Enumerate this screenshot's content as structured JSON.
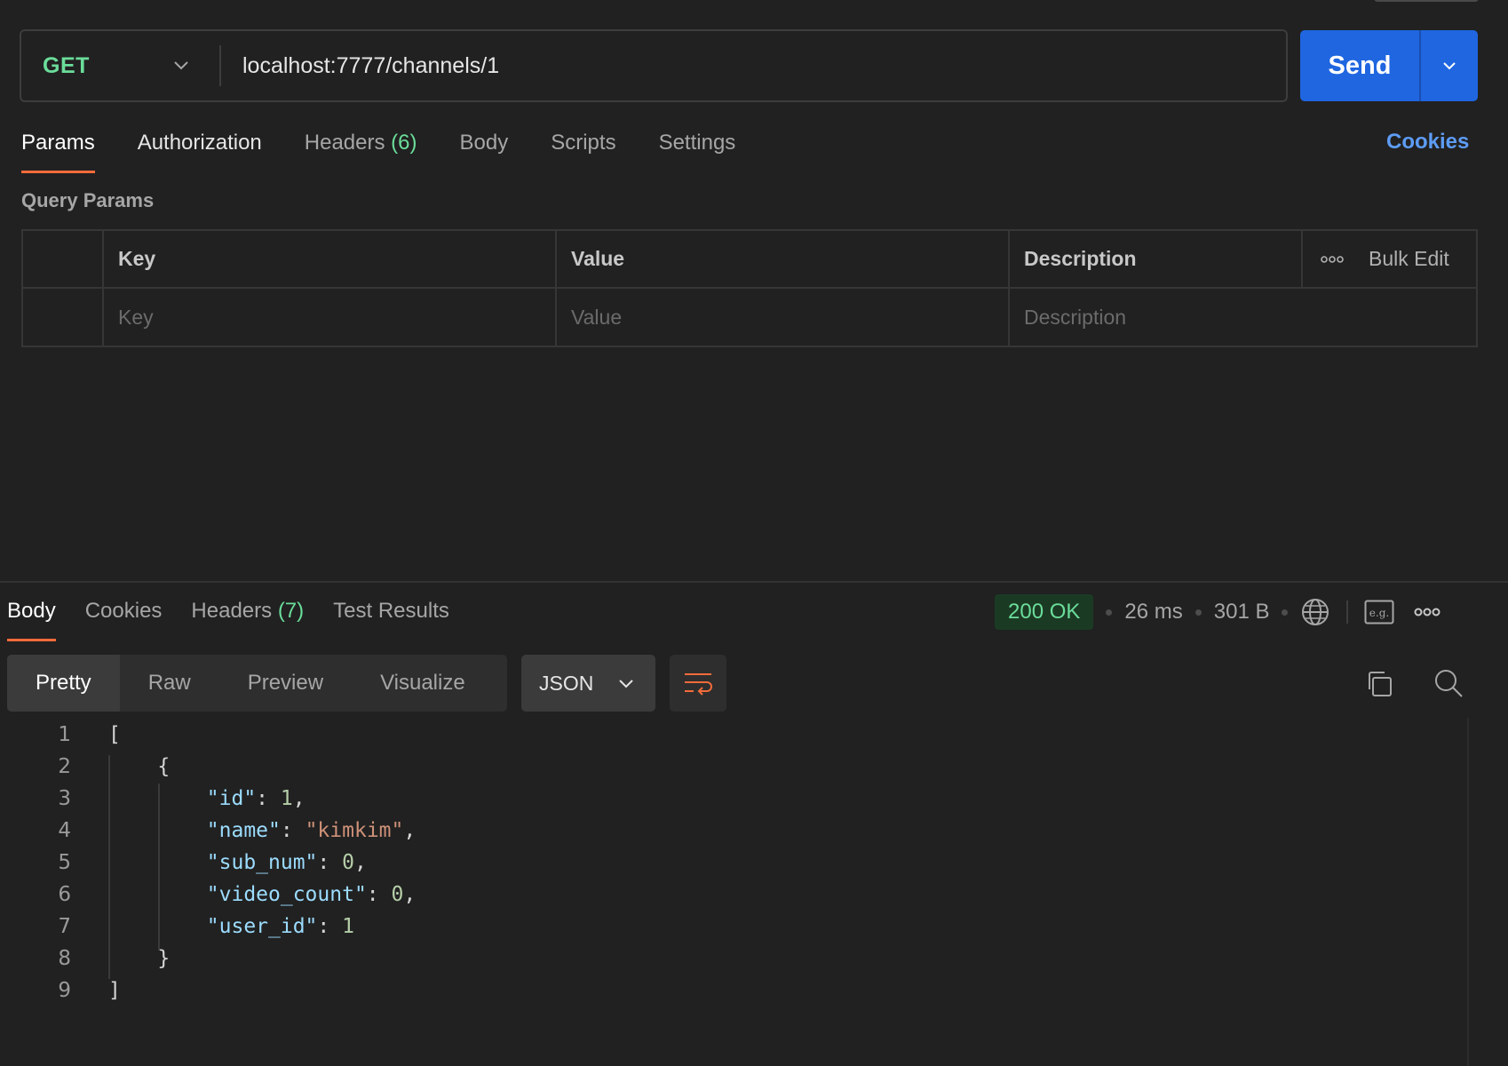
{
  "request": {
    "method": "GET",
    "url": "localhost:7777/channels/1",
    "send_label": "Send"
  },
  "request_tabs": [
    {
      "label": "Params",
      "active": true
    },
    {
      "label": "Authorization"
    },
    {
      "label": "Headers",
      "count": "(6)"
    },
    {
      "label": "Body"
    },
    {
      "label": "Scripts"
    },
    {
      "label": "Settings"
    }
  ],
  "cookies_label": "Cookies",
  "query_params": {
    "title": "Query Params",
    "columns": [
      "Key",
      "Value",
      "Description"
    ],
    "bulk_edit": "Bulk Edit",
    "placeholders": {
      "key": "Key",
      "value": "Value",
      "description": "Description"
    }
  },
  "response_tabs": [
    {
      "label": "Body",
      "active": true
    },
    {
      "label": "Cookies"
    },
    {
      "label": "Headers",
      "count": "(7)"
    },
    {
      "label": "Test Results"
    }
  ],
  "response_meta": {
    "status": "200 OK",
    "time": "26 ms",
    "size": "301 B",
    "example_label": "e.g."
  },
  "format_tabs": [
    "Pretty",
    "Raw",
    "Preview",
    "Visualize"
  ],
  "format_type": "JSON",
  "code_lines": [
    {
      "n": "1",
      "tokens": [
        [
          "punc",
          "["
        ]
      ]
    },
    {
      "n": "2",
      "tokens": [
        [
          "punc",
          "    {"
        ]
      ]
    },
    {
      "n": "3",
      "tokens": [
        [
          "punc",
          "        "
        ],
        [
          "key",
          "\"id\""
        ],
        [
          "punc",
          ": "
        ],
        [
          "num",
          "1"
        ],
        [
          "punc",
          ","
        ]
      ]
    },
    {
      "n": "4",
      "tokens": [
        [
          "punc",
          "        "
        ],
        [
          "key",
          "\"name\""
        ],
        [
          "punc",
          ": "
        ],
        [
          "str",
          "\"kimkim\""
        ],
        [
          "punc",
          ","
        ]
      ]
    },
    {
      "n": "5",
      "tokens": [
        [
          "punc",
          "        "
        ],
        [
          "key",
          "\"sub_num\""
        ],
        [
          "punc",
          ": "
        ],
        [
          "num",
          "0"
        ],
        [
          "punc",
          ","
        ]
      ]
    },
    {
      "n": "6",
      "tokens": [
        [
          "punc",
          "        "
        ],
        [
          "key",
          "\"video_count\""
        ],
        [
          "punc",
          ": "
        ],
        [
          "num",
          "0"
        ],
        [
          "punc",
          ","
        ]
      ]
    },
    {
      "n": "7",
      "tokens": [
        [
          "punc",
          "        "
        ],
        [
          "key",
          "\"user_id\""
        ],
        [
          "punc",
          ": "
        ],
        [
          "num",
          "1"
        ]
      ]
    },
    {
      "n": "8",
      "tokens": [
        [
          "punc",
          "    }"
        ]
      ]
    },
    {
      "n": "9",
      "tokens": [
        [
          "punc",
          "]"
        ]
      ]
    }
  ]
}
